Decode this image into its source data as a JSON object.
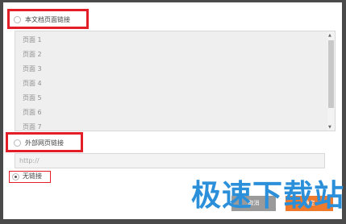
{
  "dialog": {
    "option_doc": {
      "label": "本文档页面链接",
      "checked": false
    },
    "pages": [
      "页面 1",
      "页面 2",
      "页面 3",
      "页面 4",
      "页面 5",
      "页面 6",
      "页面 7"
    ],
    "option_external": {
      "label": "外部网页链接",
      "checked": false
    },
    "url_placeholder": "http://",
    "option_none": {
      "label": "无链接",
      "checked": true
    },
    "cancel_label": "取消",
    "ok_label": "确定"
  },
  "watermark": "极速下载站",
  "colors": {
    "highlight": "#e41e26",
    "ok_button": "#f07a2c",
    "cancel_button": "#9a9a9a",
    "watermark": "#2b8fd9"
  }
}
